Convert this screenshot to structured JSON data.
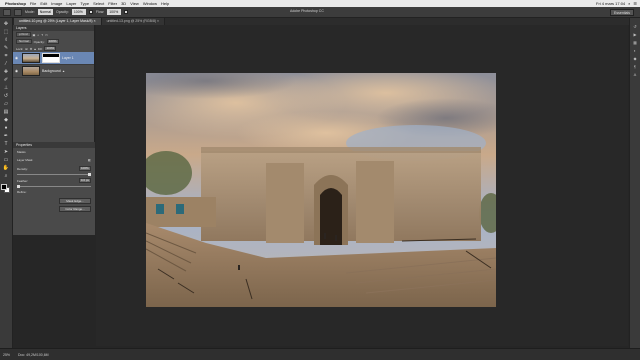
{
  "menubar": {
    "app": "Photoshop",
    "items": [
      "File",
      "Edit",
      "Image",
      "Layer",
      "Type",
      "Select",
      "Filter",
      "3D",
      "View",
      "Window",
      "Help"
    ],
    "window_title": "Adobe Photoshop CC",
    "clock": "Fri 4 mars 17:04"
  },
  "options": {
    "mode_label": "Mode:",
    "mode_value": "Normal",
    "opacity_label": "Opacity:",
    "opacity_value": "100%",
    "flow_label": "Flow:",
    "flow_value": "100%",
    "workspace": "Essentials"
  },
  "tabs": [
    {
      "label": "untitled-10.png @ 25% (Layer 1, Layer Mask/8) ×",
      "active": true
    },
    {
      "label": "untitled-13.png @ 25% (RGB/8) ×",
      "active": false
    }
  ],
  "layers_panel": {
    "tab_label": "Layers",
    "kind_label": "ρ Kind",
    "blend_mode": "Normal",
    "opacity_label": "Opacity:",
    "opacity_value": "100%",
    "lock_label": "Lock:",
    "fill_label": "Fill:",
    "fill_value": "100%",
    "layers": [
      {
        "name": "Layer 1",
        "selected": true
      },
      {
        "name": "Background",
        "selected": false
      }
    ]
  },
  "properties_panel": {
    "tab_label": "Properties",
    "section": "Masks",
    "mask_label": "Layer Mask",
    "density_label": "Density:",
    "density_value": "100%",
    "feather_label": "Feather:",
    "feather_value": "0.0 px",
    "refine_label": "Refine:",
    "mask_edge_button": "Mask Edge...",
    "color_range_button": "Color Range..."
  },
  "status": {
    "zoom": "25%",
    "doc_size": "Doc: 49,2M/100,6M"
  },
  "icons": {
    "tools": [
      "move-icon",
      "marquee-icon",
      "lasso-icon",
      "quick-select-icon",
      "crop-icon",
      "eyedropper-icon",
      "healing-icon",
      "brush-icon",
      "stamp-icon",
      "history-brush-icon",
      "eraser-icon",
      "gradient-icon",
      "blur-icon",
      "dodge-icon",
      "pen-icon",
      "type-icon",
      "path-select-icon",
      "shape-icon",
      "hand-icon",
      "zoom-icon"
    ],
    "dock": [
      "history-icon",
      "actions-icon",
      "swatches-icon",
      "adjustments-icon",
      "styles-icon",
      "paragraph-icon",
      "character-icon"
    ]
  },
  "colors": {
    "accent": "#6a87b4",
    "foreground_swatch": "#000000",
    "background_swatch": "#ffffff"
  }
}
